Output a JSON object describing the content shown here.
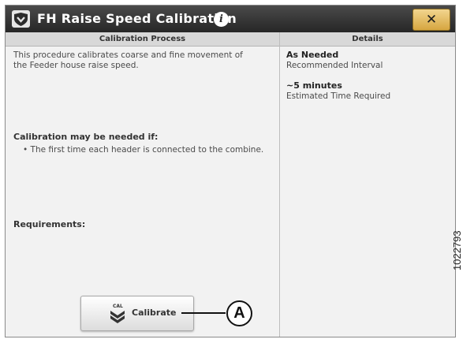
{
  "window": {
    "title": "FH Raise Speed Calibration",
    "info_icon": "info-icon",
    "info_glyph": "i",
    "close_icon": "close-icon",
    "close_glyph": "✕"
  },
  "calibration_process": {
    "header": "Calibration Process",
    "description": "This procedure calibrates coarse and fine movement of the Feeder house raise speed.",
    "needed_heading": "Calibration may be needed if:",
    "needed_items": [
      "• The first time each header is connected to the combine."
    ],
    "requirements_heading": "Requirements:",
    "calibrate_button": {
      "label": "Calibrate",
      "icon": "cal-icon",
      "icon_text": "CAL"
    }
  },
  "details": {
    "header": "Details",
    "interval_value": "As Needed",
    "interval_label": "Recommended Interval",
    "time_value": "~5 minutes",
    "time_label": "Estimated Time Required"
  },
  "annotation": {
    "callout_letter": "A",
    "figure_number": "1022793"
  },
  "colors": {
    "title_bar": "#2f2f2f",
    "close_button": "#e3b45a",
    "panel_background": "#f2f2f2",
    "column_header": "#d8d8d8"
  }
}
